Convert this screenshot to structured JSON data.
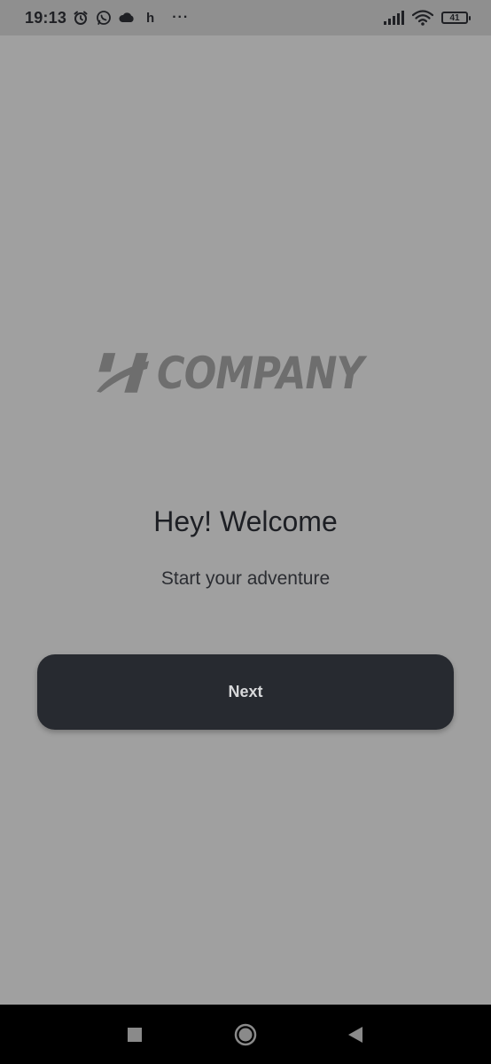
{
  "status_bar": {
    "time": "19:13",
    "extra_letter": "h",
    "more": "···",
    "battery": "41",
    "icons": [
      "alarm-icon",
      "whatsapp-icon",
      "cloud-icon",
      "signal-icon",
      "wifi-icon",
      "battery-icon"
    ]
  },
  "logo": {
    "wordmark": "COMPANY",
    "color": "#6e6e6e"
  },
  "welcome": {
    "title": "Hey! Welcome",
    "subtitle": "Start your adventure"
  },
  "actions": {
    "next_label": "Next"
  },
  "nav_bar": {
    "buttons": [
      "recents-button",
      "home-button",
      "back-button"
    ]
  },
  "colors": {
    "background": "#a0a0a0",
    "button": "#272a30",
    "button_text": "#d7d8da",
    "status_bar": "#8f8f8f",
    "nav_bar": "#000000"
  }
}
